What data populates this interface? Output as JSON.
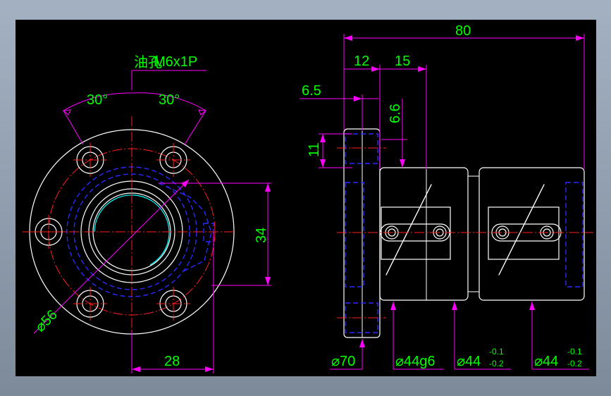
{
  "colors": {
    "background": "#000000",
    "geometry": "#ffffff",
    "hidden_lines": "#2a2aff",
    "center_lines": "#ff2020",
    "dimension_lines": "#ff00ff",
    "dimension_text": "#00ff00",
    "thread_arc": "#00ffff"
  },
  "front_view": {
    "oil_hole_label": "油孔",
    "thread_label": "M6x1P",
    "angle_left": "30°",
    "angle_right": "30°",
    "dim_34": "34",
    "dim_28": "28",
    "dim_diameter": "⌀56"
  },
  "side_view": {
    "dim_80": "80",
    "dim_12": "12",
    "dim_15": "15",
    "dim_6_5": "6.5",
    "dim_6_6": "6.6",
    "dim_11": "11",
    "dim_phi70": "⌀70",
    "dim_phi44g6": "⌀44g6",
    "dim_phi44_a": "⌀44",
    "tol_upper_a": "-0.1",
    "tol_lower_a": "-0.2",
    "dim_phi44_b": "⌀44",
    "tol_upper_b": "-0.1",
    "tol_lower_b": "-0.2"
  }
}
